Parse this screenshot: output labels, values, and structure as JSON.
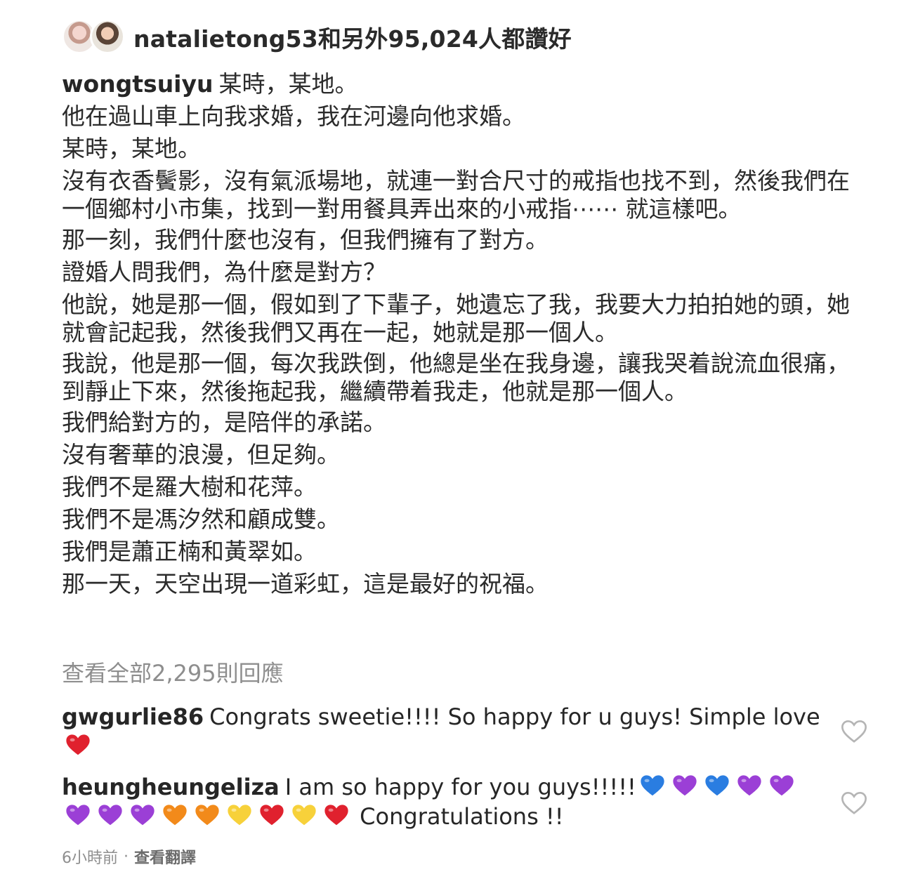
{
  "likes": {
    "text": "natalietong53和另外95,024人都讚好"
  },
  "post": {
    "username": "wongtsuiyu",
    "first_line": "某時，某地。",
    "lines": [
      "他在過山車上向我求婚，我在河邊向他求婚。",
      "某時，某地。",
      "沒有衣香鬢影，沒有氣派場地，就連一對合尺寸的戒指也找不到，然後我們在一個鄉村小市集，找到一對用餐具弄出來的小戒指⋯⋯ 就這樣吧。",
      "那一刻，我們什麼也沒有，但我們擁有了對方。",
      "證婚人問我們，為什麼是對方？",
      "他說，她是那一個，假如到了下輩子，她遺忘了我，我要大力拍拍她的頭，她就會記起我，然後我們又再在一起，她就是那一個人。",
      "我說，他是那一個，每次我跌倒，他總是坐在我身邊，讓我哭着說流血很痛，到靜止下來，然後拖起我，繼續帶着我走，他就是那一個人。",
      "我們給對方的，是陪伴的承諾。",
      "沒有奢華的浪漫，但足夠。",
      "我們不是羅大樹和花萍。",
      "我們不是馮汐然和顧成雙。",
      "我們是蕭正楠和黃翠如。",
      "那一天，天空出現一道彩虹，這是最好的祝福。"
    ]
  },
  "view_all_comments": "查看全部2,295則回應",
  "comments": [
    {
      "username": "gwgurlie86",
      "text": "Congrats sweetie!!!! So happy for u guys! Simple love",
      "emoji": [
        "red-heart"
      ]
    },
    {
      "username": "heungheungeliza",
      "text": "I am so happy for you guys!!!!!",
      "emoji": [
        "blue-heart",
        "purple-heart",
        "blue-heart",
        "purple-heart",
        "purple-heart",
        "purple-heart",
        "purple-heart",
        "purple-heart",
        "orange-heart",
        "orange-heart",
        "yellow-heart",
        "red-heart",
        "yellow-heart",
        "red-heart"
      ],
      "tail_text": "Congratulations !!"
    }
  ],
  "meta": {
    "time": "6小時前",
    "separator": "·",
    "translate": "查看翻譯"
  },
  "colors": {
    "red-heart": "#e0212e",
    "blue-heart": "#2a7de1",
    "purple-heart": "#9b3fd6",
    "orange-heart": "#f28a1a",
    "yellow-heart": "#f7d13a",
    "muted": "#8e8e8e"
  }
}
